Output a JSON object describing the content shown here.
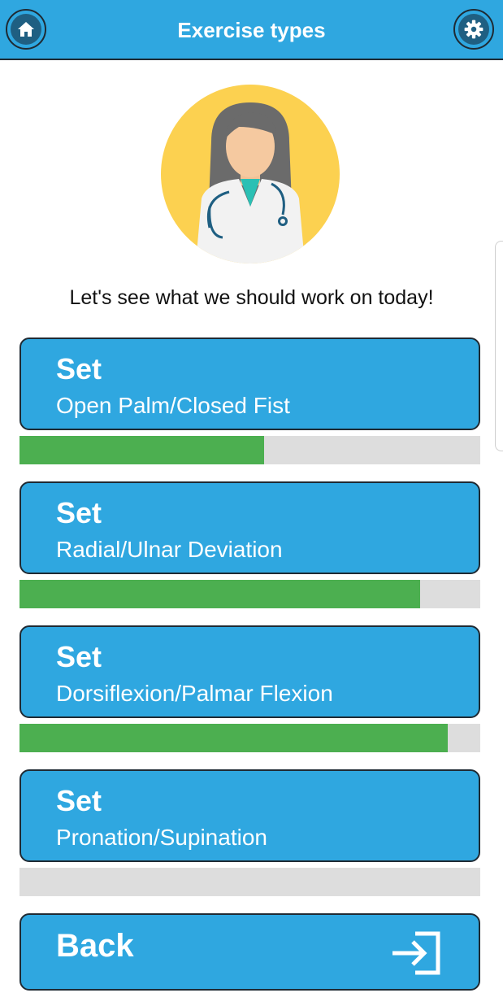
{
  "header": {
    "title": "Exercise types",
    "home_icon": "home-icon",
    "settings_icon": "gear-icon"
  },
  "avatar": {
    "icon": "doctor-avatar-icon"
  },
  "prompt": "Let's see what we should work on today!",
  "exercises": [
    {
      "heading": "Set",
      "name": "Open Palm/Closed Fist",
      "progress_percent": 53
    },
    {
      "heading": "Set",
      "name": "Radial/Ulnar Deviation",
      "progress_percent": 87
    },
    {
      "heading": "Set",
      "name": "Dorsiflexion/Palmar Flexion",
      "progress_percent": 93
    },
    {
      "heading": "Set",
      "name": "Pronation/Supination",
      "progress_percent": 0
    }
  ],
  "back": {
    "label": "Back",
    "icon": "sign-in-arrow-icon"
  },
  "colors": {
    "primary": "#2fa7e0",
    "progress": "#4caf50",
    "track": "#dddddd",
    "border": "#1f2a33"
  }
}
